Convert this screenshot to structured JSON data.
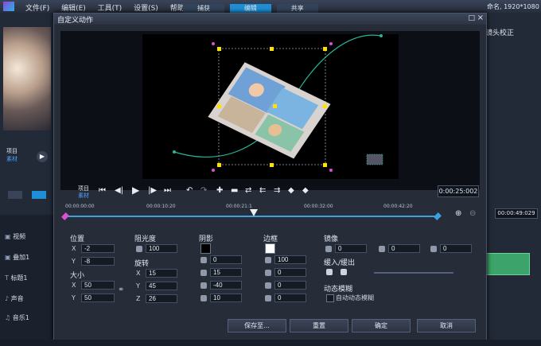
{
  "app": {
    "menu": [
      "文件(F)",
      "编辑(E)",
      "工具(T)",
      "设置(S)",
      "帮助(H)"
    ],
    "tabs": [
      "捕获",
      "编辑",
      "共享"
    ],
    "right_title": "命名, 1920*1080",
    "right_panel_label": "镜头校正",
    "right_time": "00:00:49:029",
    "left_project": "项目",
    "left_material": "素材",
    "tracks": [
      "视频",
      "叠加1",
      "标题1",
      "声音",
      "音乐1"
    ]
  },
  "dialog": {
    "title": "自定义动作",
    "max_icon": "□",
    "close_icon": "×",
    "transport": {
      "project_label": "项目",
      "material_label": "素材",
      "time": "0:00:25:002"
    },
    "ruler_ticks": [
      "00:00:00:00",
      "00:00:10:20",
      "00:00:21:1",
      "00:00:32:00",
      "00:00:42:20"
    ],
    "position": {
      "label": "位置",
      "x_label": "X",
      "x": "-2",
      "y_label": "Y",
      "y": "-8"
    },
    "size": {
      "label": "大小",
      "x_label": "X",
      "x": "50",
      "y_label": "Y",
      "y": "50"
    },
    "opacity": {
      "label": "阻光度",
      "value": "100"
    },
    "rotation": {
      "label": "旋转",
      "x_label": "X",
      "x": "15",
      "y_label": "Y",
      "y": "45",
      "z_label": "Z",
      "z": "26"
    },
    "shadow": {
      "label": "阴影",
      "color": "#000000",
      "v1": "0",
      "v2": "15",
      "v3": "-40",
      "v4": "10"
    },
    "border": {
      "label": "边框",
      "color": "#ffffff",
      "v1": "100",
      "v2": "0",
      "v3": "0",
      "v4": "0"
    },
    "mirror": {
      "label": "镜像",
      "v1": "0",
      "v2": "0",
      "v3": "0"
    },
    "ease": {
      "label": "缓入/缓出"
    },
    "motion_blur": {
      "label": "动态模糊",
      "auto_label": "自动动态模糊"
    },
    "buttons": {
      "save": "保存至...",
      "reset": "重置",
      "ok": "确定",
      "cancel": "取消"
    }
  },
  "colors": {
    "accent": "#1e8fd6",
    "curve": "#27b59a",
    "handle": "#ffe100",
    "node": "#d94fd8"
  }
}
